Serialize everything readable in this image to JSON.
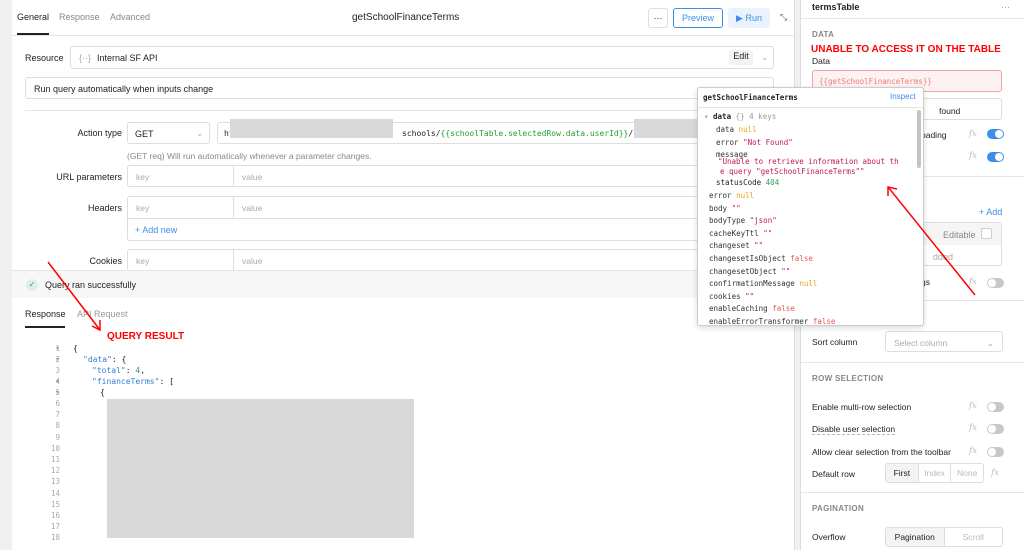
{
  "query": {
    "tabs": [
      "General",
      "Response",
      "Advanced"
    ],
    "title": "getSchoolFinanceTerms",
    "more_label": "···",
    "preview_label": "Preview",
    "run_label": "Run",
    "resource_label": "Resource",
    "resource_value": "Internal SF API",
    "edit_label": "Edit",
    "run_mode": "Run query automatically when inputs change",
    "action_type_label": "Action type",
    "method": "GET",
    "url_prefix": "ht",
    "url_mid": "schools/",
    "url_template": "{{schoolTable.selectedRow.data.userId}}",
    "url_suffix": "/fi",
    "hint": "(GET req) Will run automatically whenever a parameter changes.",
    "url_params_label": "URL parameters",
    "headers_label": "Headers",
    "cookies_label": "Cookies",
    "key_ph": "key",
    "value_ph": "value",
    "add_new": "+ Add new",
    "status": "Query ran successfully"
  },
  "response": {
    "tabs": [
      "Response",
      "API Request"
    ],
    "lines": [
      {
        "n": "1",
        "t": "{"
      },
      {
        "n": "2",
        "k": "\"data\"",
        "t": ": {"
      },
      {
        "n": "3",
        "k": "\"total\"",
        "t": ": ",
        "v": "4",
        "e": ","
      },
      {
        "n": "4",
        "k": "\"financeTerms\"",
        "t": ": ["
      },
      {
        "n": "5",
        "t": "{"
      }
    ],
    "more_numbers": [
      "6",
      "7",
      "8",
      "9",
      "10",
      "11",
      "12",
      "13",
      "14",
      "15",
      "16",
      "17",
      "18"
    ]
  },
  "popover": {
    "title": "getSchoolFinanceTerms",
    "inspect": "Inspect",
    "root": "data",
    "root_meta": "{}  4 keys",
    "nested": [
      {
        "k": "data",
        "v": "null",
        "c": "nul"
      },
      {
        "k": "error",
        "v": "\"Not Found\"",
        "c": "str"
      },
      {
        "k": "message",
        "v": "",
        "c": "str"
      }
    ],
    "message_value_1": "\"Unable to retrieve information about th",
    "message_value_2": "e query \"getSchoolFinanceTerms\"\"",
    "status_key": "statusCode",
    "status_val": "404",
    "items": [
      {
        "k": "error",
        "v": "null",
        "c": "nul"
      },
      {
        "k": "body",
        "v": "\"\"",
        "c": "str"
      },
      {
        "k": "bodyType",
        "v": "\"json\"",
        "c": "str"
      },
      {
        "k": "cacheKeyTtl",
        "v": "\"\"",
        "c": "str"
      },
      {
        "k": "changeset",
        "v": "\"\"",
        "c": "str"
      },
      {
        "k": "changesetIsObject",
        "v": "false",
        "c": "fal"
      },
      {
        "k": "changesetObject",
        "v": "\"\"",
        "c": "str"
      },
      {
        "k": "confirmationMessage",
        "v": "null",
        "c": "nul"
      },
      {
        "k": "cookies",
        "v": "\"\"",
        "c": "str"
      },
      {
        "k": "enableCaching",
        "v": "false",
        "c": "fal"
      },
      {
        "k": "enableErrorTransformer",
        "v": "false",
        "c": "fal"
      }
    ]
  },
  "inspector": {
    "component": "termsTable",
    "more": "···",
    "data_section": "DATA",
    "data_label": "Data",
    "data_value": "{{getSchoolFinanceTerms}}",
    "empty_text": "found",
    "loading_label": "oading",
    "add_label": "+ Add",
    "editable_label": "Editable",
    "added_text": "dded",
    "tags_label": "gs",
    "sort_label": "Sort column",
    "sort_ph": "Select column",
    "row_selection": "ROW SELECTION",
    "multi": "Enable multi-row selection",
    "disable": "Disable user selection",
    "allow_clear": "Allow clear selection from the toolbar",
    "default_row": "Default row",
    "default_opts": [
      "First",
      "Index",
      "None"
    ],
    "pagination": "PAGINATION",
    "overflow": "Overflow",
    "overflow_opts": [
      "Pagination",
      "Scroll"
    ],
    "fx": "fx"
  },
  "annotations": {
    "table": "UNABLE TO ACCESS IT ON THE TABLE",
    "result": "QUERY RESULT"
  },
  "colors": {
    "accent": "#3b8fe8",
    "annotation": "#ff0000"
  }
}
